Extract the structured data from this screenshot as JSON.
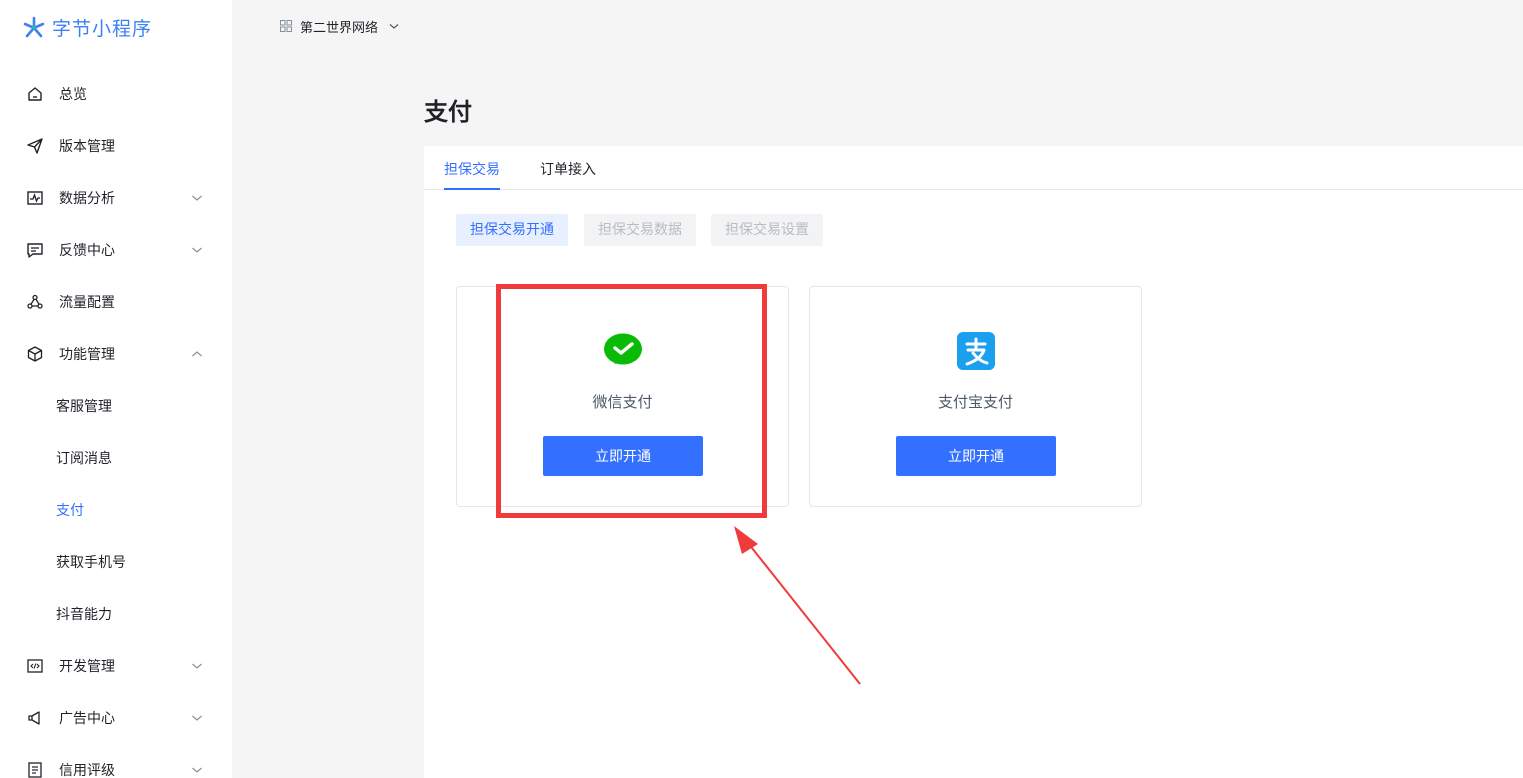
{
  "brand": {
    "name": "字节小程序",
    "color": "#3b82f6"
  },
  "sidebar": {
    "items": [
      {
        "label": "总览",
        "icon": "home-icon",
        "chevron": ""
      },
      {
        "label": "版本管理",
        "icon": "send-icon",
        "chevron": ""
      },
      {
        "label": "数据分析",
        "icon": "chart-icon",
        "chevron": "down"
      },
      {
        "label": "反馈中心",
        "icon": "message-icon",
        "chevron": "down"
      },
      {
        "label": "流量配置",
        "icon": "share-nodes-icon",
        "chevron": ""
      },
      {
        "label": "功能管理",
        "icon": "cube-icon",
        "chevron": "up"
      },
      {
        "label": "开发管理",
        "icon": "code-icon",
        "chevron": "down"
      },
      {
        "label": "广告中心",
        "icon": "megaphone-icon",
        "chevron": "down"
      },
      {
        "label": "信用评级",
        "icon": "document-icon",
        "chevron": "down"
      }
    ],
    "sub_items": [
      {
        "label": "客服管理",
        "active": false
      },
      {
        "label": "订阅消息",
        "active": false
      },
      {
        "label": "支付",
        "active": true
      },
      {
        "label": "获取手机号",
        "active": false
      },
      {
        "label": "抖音能力",
        "active": false
      }
    ]
  },
  "header": {
    "app_name": "第二世界网络",
    "app_icon": "grid-icon"
  },
  "page": {
    "title": "支付"
  },
  "tabs": [
    {
      "label": "担保交易",
      "active": true
    },
    {
      "label": "订单接入",
      "active": false
    }
  ],
  "subtabs": [
    {
      "label": "担保交易开通",
      "state": "active"
    },
    {
      "label": "担保交易数据",
      "state": "disabled"
    },
    {
      "label": "担保交易设置",
      "state": "disabled"
    }
  ],
  "cards": [
    {
      "name": "微信支付",
      "icon": "wechat-pay-icon",
      "button": "立即开通",
      "icon_color": "#09bb07"
    },
    {
      "name": "支付宝支付",
      "icon": "alipay-icon",
      "button": "立即开通",
      "icon_color": "#1aa0ee"
    }
  ],
  "colors": {
    "accent": "#3370ff",
    "annotation": "#ef3b3b"
  }
}
